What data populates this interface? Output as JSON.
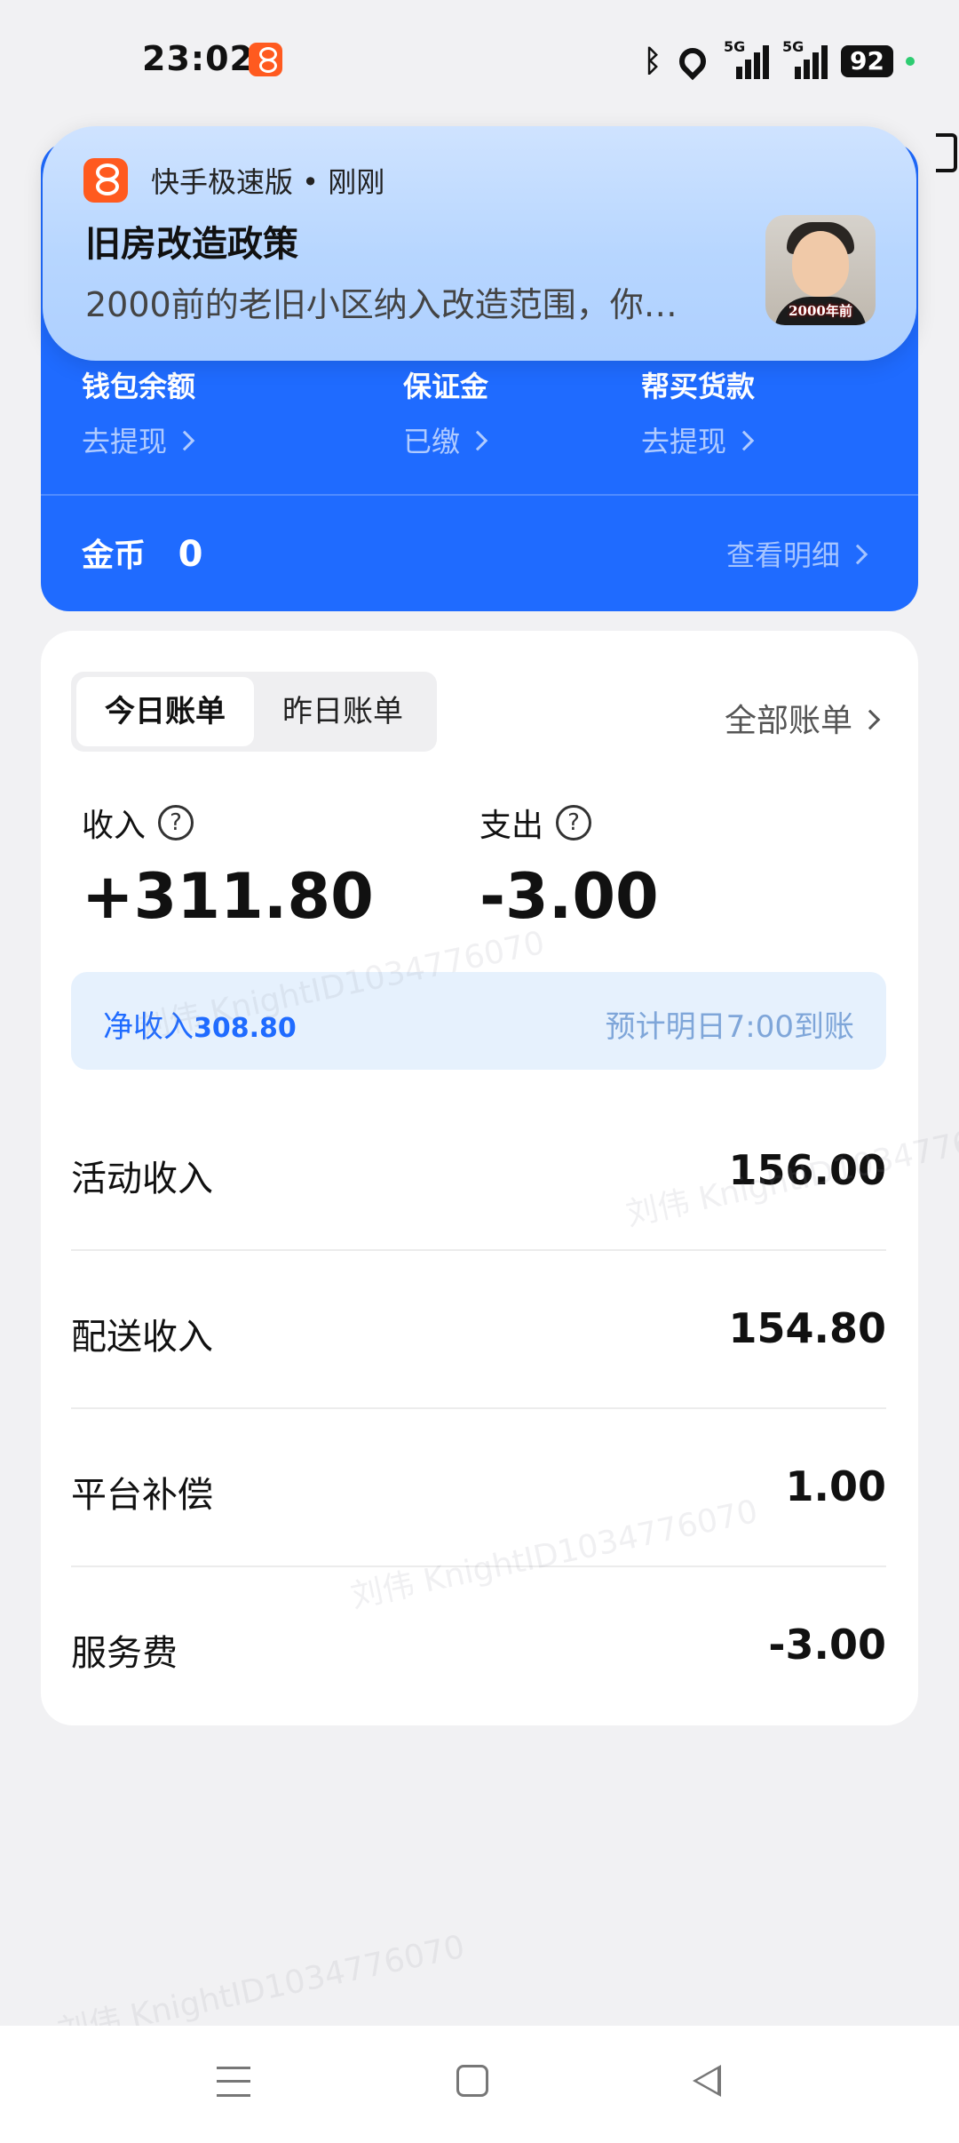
{
  "status_bar": {
    "time": "23:02",
    "bluetooth_icon": "bluetooth-icon",
    "signal_1": "5G",
    "signal_2": "5G",
    "battery": "92"
  },
  "notification": {
    "app_line": "快手极速版 • 刚刚",
    "title": "旧房改造政策",
    "body": "2000前的老旧小区纳入改造范围，你…",
    "thumb_caption": "2000年前"
  },
  "wallet": {
    "balance_label": "钱包余额",
    "balance_action": "去提现",
    "deposit_label": "保证金",
    "deposit_status": "已缴",
    "purchase_label": "帮买货款",
    "purchase_action": "去提现",
    "coin_label": "金币",
    "coin_value": "0",
    "detail_link": "查看明细"
  },
  "bills": {
    "tab_today": "今日账单",
    "tab_yesterday": "昨日账单",
    "all_bills": "全部账单",
    "income_label": "收入",
    "income_value": "+311.80",
    "expense_label": "支出",
    "expense_value": "-3.00",
    "net_label": "净收入",
    "net_value": "308.80",
    "arrival_note": "预计明日7:00到账",
    "items": [
      {
        "label": "活动收入",
        "value": "156.00"
      },
      {
        "label": "配送收入",
        "value": "154.80"
      },
      {
        "label": "平台补偿",
        "value": "1.00"
      },
      {
        "label": "服务费",
        "value": "-3.00"
      }
    ]
  },
  "watermark": "刘伟 KnightID1034776070",
  "colors": {
    "primary_blue": "#1f6bff",
    "background": "#f1f1f3",
    "net_bg": "#e6f1fd"
  }
}
